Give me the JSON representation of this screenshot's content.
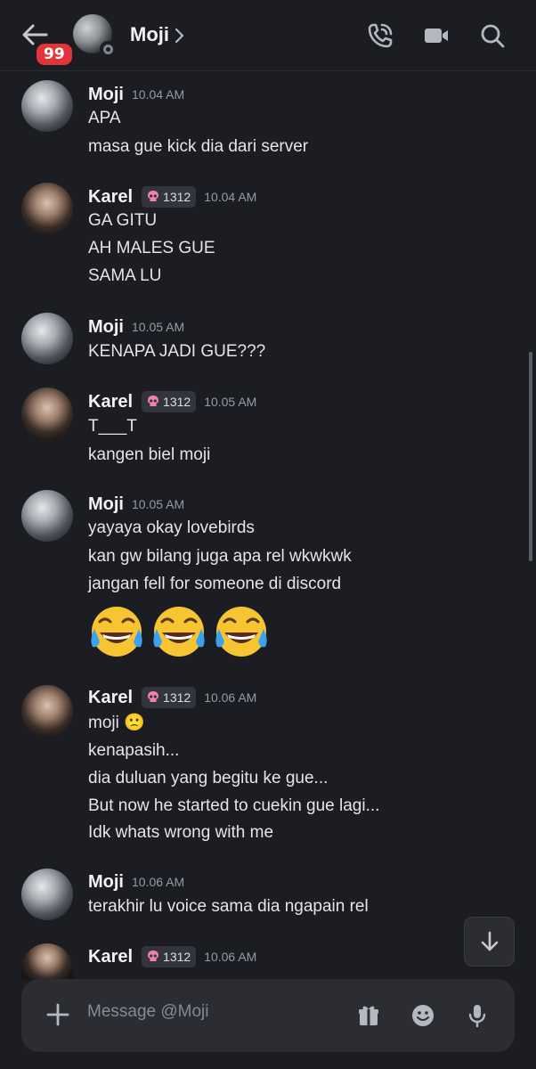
{
  "header": {
    "back_label": "back",
    "unread_count": "99",
    "name": "Moji",
    "icons": [
      "back-arrow-icon",
      "phone-call-icon",
      "video-camera-icon",
      "search-icon",
      "chevron-right-icon"
    ]
  },
  "messages": [
    {
      "author": "Moji",
      "time": "10.04 AM",
      "lines": [
        "APA",
        "masa gue kick dia dari server"
      ]
    },
    {
      "author": "Karel",
      "tag": "1312",
      "time": "10.04 AM",
      "lines": [
        "GA GITU",
        "AH MALES GUE",
        "SAMA LU"
      ]
    },
    {
      "author": "Moji",
      "time": "10.05 AM",
      "lines": [
        "KENAPA JADI GUE???"
      ]
    },
    {
      "author": "Karel",
      "tag": "1312",
      "time": "10.05 AM",
      "lines": [
        "T___T",
        "kangen biel moji"
      ]
    },
    {
      "author": "Moji",
      "time": "10.05 AM",
      "lines": [
        "yayaya okay lovebirds",
        "kan gw bilang juga apa rel wkwkwk",
        "jangan fell for someone di discord"
      ],
      "emoji": [
        "😂",
        "😂",
        "😂"
      ]
    },
    {
      "author": "Karel",
      "tag": "1312",
      "time": "10.06 AM",
      "lines": [
        "moji 🙁",
        "kenapasih...",
        "dia duluan yang begitu ke gue...",
        "But now he started to cuekin gue lagi...",
        "Idk whats wrong with me"
      ]
    },
    {
      "author": "Moji",
      "time": "10.06 AM",
      "lines": [
        "terakhir lu voice sama dia ngapain rel"
      ]
    },
    {
      "author": "Karel",
      "tag": "1312",
      "time": "10.06 AM",
      "lines": [
        ""
      ]
    }
  ],
  "composer": {
    "placeholder": "Message @Moji",
    "icons": [
      "plus-icon",
      "gift-icon",
      "emoji-icon",
      "microphone-icon"
    ]
  },
  "colors": {
    "background": "#1c1d22",
    "badge": "#e0353b",
    "tag_background": "#33353c",
    "skull": "#f47fb5"
  }
}
